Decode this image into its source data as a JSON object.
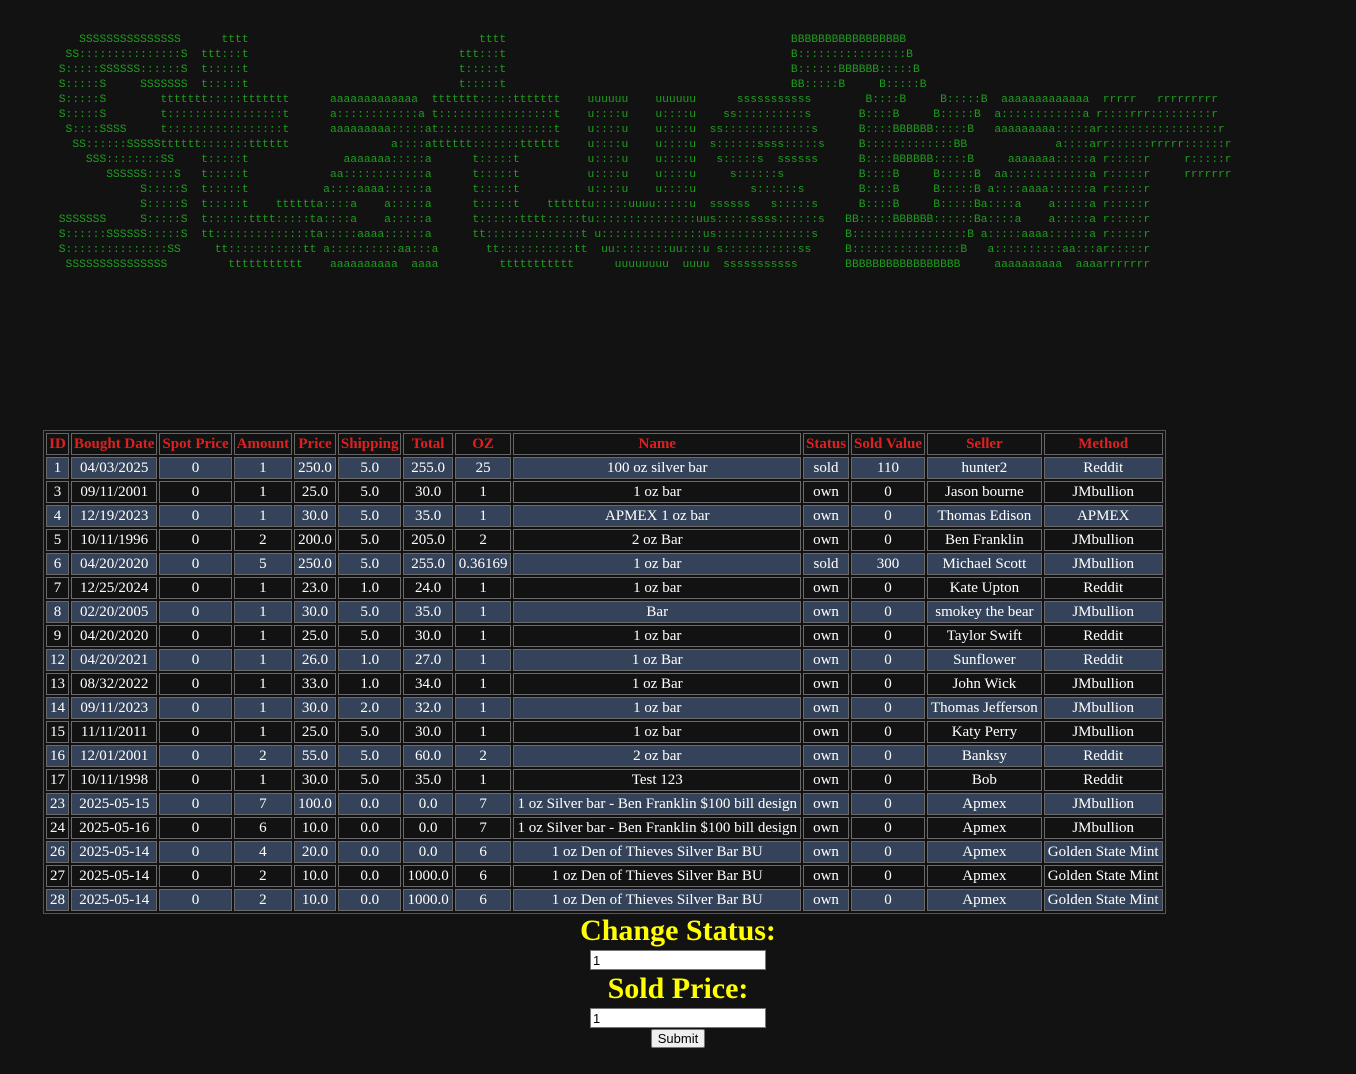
{
  "banner": {
    "ascii_art": "    SSSSSSSSSSSSSSS      tttt                                  tttt                                          BBBBBBBBBBBBBBBBB\n  SS:::::::::::::::S  ttt:::t                               ttt:::t                                          B::::::::::::::::B\n S:::::SSSSSS::::::S  t:::::t                               t:::::t                                          B::::::BBBBBB:::::B\n S:::::S     SSSSSSS  t:::::t                               t:::::t                                          BB:::::B     B:::::B\n S:::::S        ttttttt:::::ttttttt      aaaaaaaaaaaaa  ttttttt:::::ttttttt    uuuuuu    uuuuuu      sssssssssss        B::::B     B:::::B  aaaaaaaaaaaaa  rrrrr   rrrrrrrrr\n S:::::S        t:::::::::::::::::t      a::::::::::::a t:::::::::::::::::t    u::::u    u::::u    ss::::::::::s       B::::B     B:::::B  a::::::::::::a r::::rrr:::::::::r\n  S::::SSSS     t:::::::::::::::::t      aaaaaaaaa:::::at:::::::::::::::::t    u::::u    u::::u  ss:::::::::::::s      B::::BBBBBB:::::B   aaaaaaaaa:::::ar:::::::::::::::::r\n   SS::::::SSSSStttttt:::::::tttttt               a::::atttttt:::::::tttttt    u::::u    u::::u  s::::::ssss:::::s     B:::::::::::::BB             a::::arr::::::rrrrr::::::r\n     SSS::::::::SS    t:::::t              aaaaaaa:::::a      t:::::t          u::::u    u::::u   s:::::s  ssssss      B::::BBBBBB:::::B     aaaaaaa:::::a r:::::r     r:::::r\n        SSSSSS::::S   t:::::t            aa::::::::::::a      t:::::t          u::::u    u::::u     s::::::s           B::::B     B:::::B  aa::::::::::::a r:::::r     rrrrrrr\n             S:::::S  t:::::t           a::::aaaa::::::a      t:::::t          u::::u    u::::u        s::::::s        B::::B     B:::::B a::::aaaa::::::a r:::::r\n             S:::::S  t:::::t    tttttta::::a    a:::::a      t:::::t    ttttttu:::::uuuu:::::u  ssssss   s:::::s      B::::B     B:::::Ba::::a    a:::::a r:::::r\n SSSSSSS     S:::::S  t::::::tttt:::::ta::::a    a:::::a      t::::::tttt:::::tu:::::::::::::::uus:::::ssss::::::s   BB:::::BBBBBB::::::Ba::::a    a:::::a r:::::r\n S::::::SSSSSS:::::S  tt::::::::::::::ta:::::aaaa::::::a      tt::::::::::::::t u:::::::::::::::us::::::::::::::s    B:::::::::::::::::B a:::::aaaa::::::a r:::::r\n S:::::::::::::::SS     tt:::::::::::tt a::::::::::aa:::a       tt:::::::::::tt  uu::::::::uu:::u s:::::::::::ss     B::::::::::::::::B   a::::::::::aa:::ar:::::r\n  SSSSSSSSSSSSSSS         ttttttttttt    aaaaaaaaaa  aaaa         ttttttttttt      uuuuuuuu  uuuu  sssssssssss       BBBBBBBBBBBBBBBBB     aaaaaaaaaa  aaaarrrrrrr"
  },
  "table": {
    "headers": [
      "ID",
      "Bought Date",
      "Spot Price",
      "Amount",
      "Price",
      "Shipping",
      "Total",
      "OZ",
      "Name",
      "Status",
      "Sold Value",
      "Seller",
      "Method"
    ],
    "rows": [
      [
        "1",
        "04/03/2025",
        "0",
        "1",
        "250.0",
        "5.0",
        "255.0",
        "25",
        "100 oz silver bar",
        "sold",
        "110",
        "hunter2",
        "Reddit"
      ],
      [
        "3",
        "09/11/2001",
        "0",
        "1",
        "25.0",
        "5.0",
        "30.0",
        "1",
        "1 oz bar",
        "own",
        "0",
        "Jason bourne",
        "JMbullion"
      ],
      [
        "4",
        "12/19/2023",
        "0",
        "1",
        "30.0",
        "5.0",
        "35.0",
        "1",
        "APMEX 1 oz bar",
        "own",
        "0",
        "Thomas Edison",
        "APMEX"
      ],
      [
        "5",
        "10/11/1996",
        "0",
        "2",
        "200.0",
        "5.0",
        "205.0",
        "2",
        "2 oz Bar",
        "own",
        "0",
        "Ben Franklin",
        "JMbullion"
      ],
      [
        "6",
        "04/20/2020",
        "0",
        "5",
        "250.0",
        "5.0",
        "255.0",
        "0.36169",
        "1 oz bar",
        "sold",
        "300",
        "Michael Scott",
        "JMbullion"
      ],
      [
        "7",
        "12/25/2024",
        "0",
        "1",
        "23.0",
        "1.0",
        "24.0",
        "1",
        "1 oz bar",
        "own",
        "0",
        "Kate Upton",
        "Reddit"
      ],
      [
        "8",
        "02/20/2005",
        "0",
        "1",
        "30.0",
        "5.0",
        "35.0",
        "1",
        "Bar",
        "own",
        "0",
        "smokey the bear",
        "JMbullion"
      ],
      [
        "9",
        "04/20/2020",
        "0",
        "1",
        "25.0",
        "5.0",
        "30.0",
        "1",
        "1 oz bar",
        "own",
        "0",
        "Taylor Swift",
        "Reddit"
      ],
      [
        "12",
        "04/20/2021",
        "0",
        "1",
        "26.0",
        "1.0",
        "27.0",
        "1",
        "1 oz Bar",
        "own",
        "0",
        "Sunflower",
        "Reddit"
      ],
      [
        "13",
        "08/32/2022",
        "0",
        "1",
        "33.0",
        "1.0",
        "34.0",
        "1",
        "1 oz Bar",
        "own",
        "0",
        "John Wick",
        "JMbullion"
      ],
      [
        "14",
        "09/11/2023",
        "0",
        "1",
        "30.0",
        "2.0",
        "32.0",
        "1",
        "1 oz bar",
        "own",
        "0",
        "Thomas Jefferson",
        "JMbullion"
      ],
      [
        "15",
        "11/11/2011",
        "0",
        "1",
        "25.0",
        "5.0",
        "30.0",
        "1",
        "1 oz bar",
        "own",
        "0",
        "Katy Perry",
        "JMbullion"
      ],
      [
        "16",
        "12/01/2001",
        "0",
        "2",
        "55.0",
        "5.0",
        "60.0",
        "2",
        "2 oz bar",
        "own",
        "0",
        "Banksy",
        "Reddit"
      ],
      [
        "17",
        "10/11/1998",
        "0",
        "1",
        "30.0",
        "5.0",
        "35.0",
        "1",
        "Test 123",
        "own",
        "0",
        "Bob",
        "Reddit"
      ],
      [
        "23",
        "2025-05-15",
        "0",
        "7",
        "100.0",
        "0.0",
        "0.0",
        "7",
        "1 oz Silver bar - Ben Franklin $100 bill design",
        "own",
        "0",
        "Apmex",
        "JMbullion"
      ],
      [
        "24",
        "2025-05-16",
        "0",
        "6",
        "10.0",
        "0.0",
        "0.0",
        "7",
        "1 oz Silver bar - Ben Franklin $100 bill design",
        "own",
        "0",
        "Apmex",
        "JMbullion"
      ],
      [
        "26",
        "2025-05-14",
        "0",
        "4",
        "20.0",
        "0.0",
        "0.0",
        "6",
        "1 oz Den of Thieves Silver Bar BU",
        "own",
        "0",
        "Apmex",
        "Golden State Mint"
      ],
      [
        "27",
        "2025-05-14",
        "0",
        "2",
        "10.0",
        "0.0",
        "1000.0",
        "6",
        "1 oz Den of Thieves Silver Bar BU",
        "own",
        "0",
        "Apmex",
        "Golden State Mint"
      ],
      [
        "28",
        "2025-05-14",
        "0",
        "2",
        "10.0",
        "0.0",
        "1000.0",
        "6",
        "1 oz Den of Thieves Silver Bar BU",
        "own",
        "0",
        "Apmex",
        "Golden State Mint"
      ]
    ]
  },
  "form": {
    "status_heading": "Change Status:",
    "status_value": "1",
    "sold_price_heading": "Sold Price:",
    "sold_price_value": "1",
    "submit_label": "Submit"
  },
  "colors": {
    "background": "#121212",
    "header_text": "#e02020",
    "form_heading": "#ffff00",
    "odd_row": "#34435a",
    "ascii_green": "#1e9e1e"
  }
}
